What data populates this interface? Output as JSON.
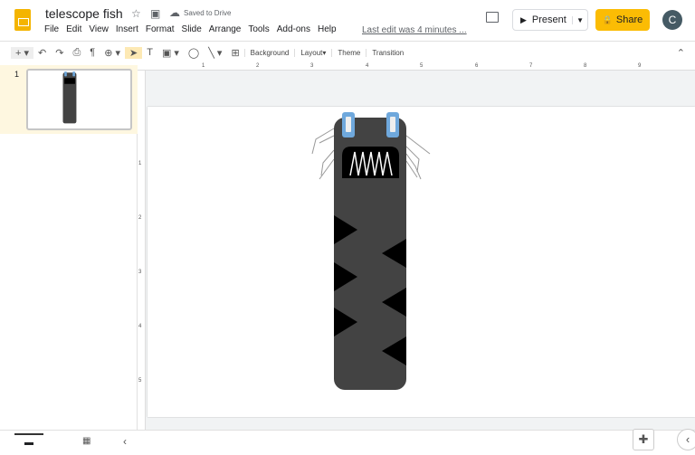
{
  "header": {
    "title": "telescope fish",
    "saved": "Saved to Drive",
    "last_edit": "Last edit was 4 minutes ...",
    "present": "Present",
    "share": "Share",
    "avatar": "C"
  },
  "menu": [
    "File",
    "Edit",
    "View",
    "Insert",
    "Format",
    "Slide",
    "Arrange",
    "Tools",
    "Add-ons",
    "Help"
  ],
  "toolbar": {
    "background": "Background",
    "layout": "Layout",
    "theme": "Theme",
    "transition": "Transition"
  },
  "filmstrip": {
    "slide_number": "1"
  },
  "ruler": {
    "top": [
      "1",
      "2",
      "3",
      "4",
      "5",
      "6",
      "7",
      "8",
      "9"
    ],
    "left": [
      "1",
      "2",
      "3",
      "4",
      "5"
    ]
  },
  "colors": {
    "accent": "#fbbc04",
    "fish_body": "#434343",
    "eye": "#6fa8dc"
  }
}
